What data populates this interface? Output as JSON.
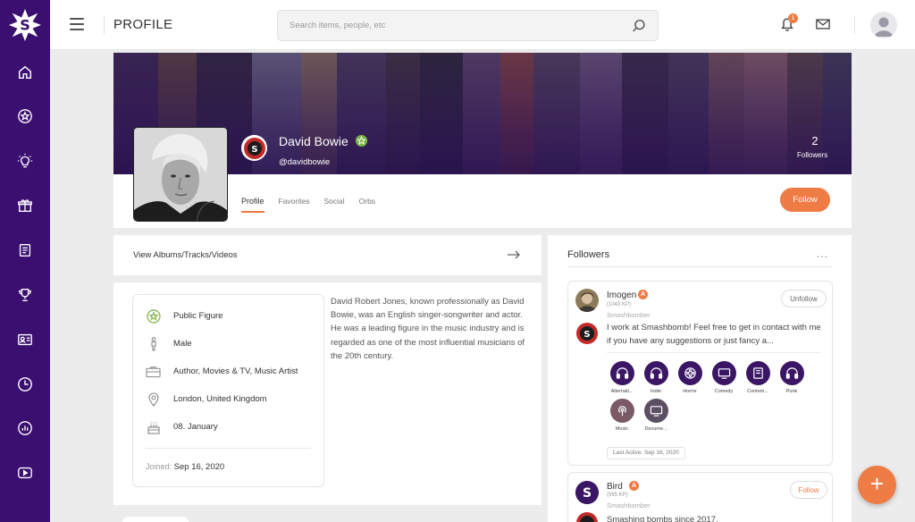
{
  "colors": {
    "sidebar": "#3a0f70",
    "accent": "#ef7b45",
    "genre_circle": "#3a1664"
  },
  "sidebar": {
    "logo_icon": "smashbomb-logo-icon",
    "items": [
      {
        "icon": "home-icon"
      },
      {
        "icon": "star-icon"
      },
      {
        "icon": "lightbulb-icon"
      },
      {
        "icon": "gift-icon"
      },
      {
        "icon": "document-icon"
      },
      {
        "icon": "trophy-icon"
      },
      {
        "icon": "id-card-icon"
      },
      {
        "icon": "clock-icon"
      },
      {
        "icon": "chart-bubble-icon"
      },
      {
        "icon": "play-icon"
      }
    ]
  },
  "topbar": {
    "title": "PROFILE",
    "search_placeholder": "Search items, people, etc",
    "notification_count": "1"
  },
  "profile": {
    "name": "David Bowie",
    "handle": "@davidbowie",
    "followers_count": "2",
    "followers_label": "Followers",
    "follow_label": "Follow",
    "tabs": [
      "Profile",
      "Favorites",
      "Social",
      "Orbs"
    ]
  },
  "albums": {
    "label": "View Albums/Tracks/Videos"
  },
  "info": {
    "rows": [
      {
        "icon": "star-badge-icon",
        "text": "Public Figure"
      },
      {
        "icon": "person-icon",
        "text": "Male"
      },
      {
        "icon": "briefcase-icon",
        "text": "Author, Movies & TV, Music Artist"
      },
      {
        "icon": "location-pin-icon",
        "text": "London, United Kingdom"
      },
      {
        "icon": "birthday-cake-icon",
        "text": "08. January"
      }
    ],
    "joined_label": "Joined:",
    "joined_date": "Sep 16, 2020",
    "bio": "David Robert Jones, known professionally as David Bowie, was an English singer-songwriter and actor. He was a leading figure in the music industry and is regarded as one of the most influential musicians of the 20th century."
  },
  "followers": {
    "title": "Followers",
    "more": "...",
    "items": [
      {
        "name": "Imogen",
        "level": "A",
        "kp": "(1043 KP)",
        "role": "Smashbomber",
        "button": "Unfollow",
        "message": "I work at Smashbomb! Feel free to get in contact with me if you have any suggestions or just fancy a...",
        "genres": [
          "Alternati...",
          "Indie",
          "Horror",
          "Comedy",
          "Contem...",
          "Punk",
          "Music",
          "Docume..."
        ],
        "last_active": "Last Active: Sep 16, 2020"
      },
      {
        "name": "Bird",
        "level": "A",
        "kp": "(995 KP)",
        "role": "Smashbomber",
        "button": "Follow",
        "message": "Smashing bombs since 2017."
      }
    ]
  },
  "fab_label": "+"
}
